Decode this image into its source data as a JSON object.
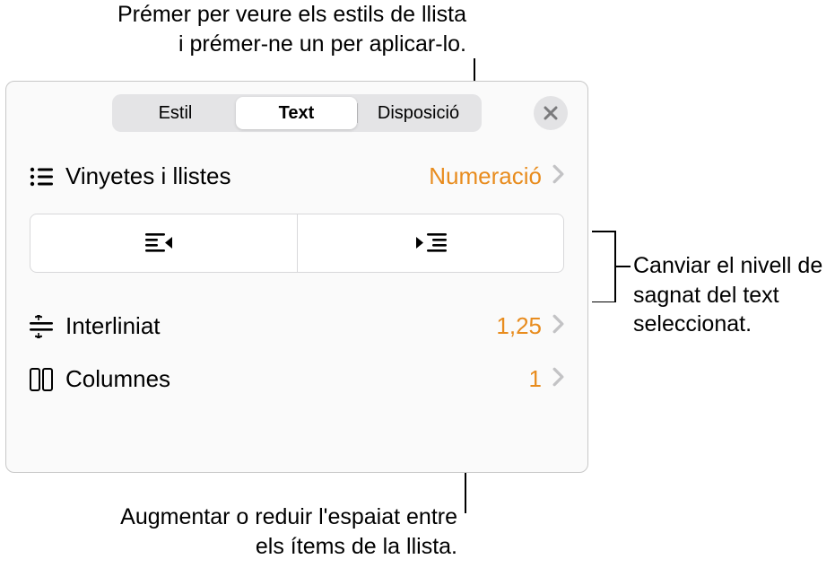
{
  "callouts": {
    "top": "Prémer per veure els estils de llista i prémer-ne un per aplicar-lo.",
    "right": "Canviar el nivell de sagnat del text seleccionat.",
    "bottom": "Augmentar o reduir l'espaiat entre els ítems de la llista."
  },
  "tabs": {
    "style": "Estil",
    "text": "Text",
    "layout": "Disposició",
    "active": "text"
  },
  "bullets": {
    "label": "Vinyetes i llistes",
    "value": "Numeració"
  },
  "spacing": {
    "label": "Interliniat",
    "value": "1,25"
  },
  "columns": {
    "label": "Columnes",
    "value": "1"
  }
}
